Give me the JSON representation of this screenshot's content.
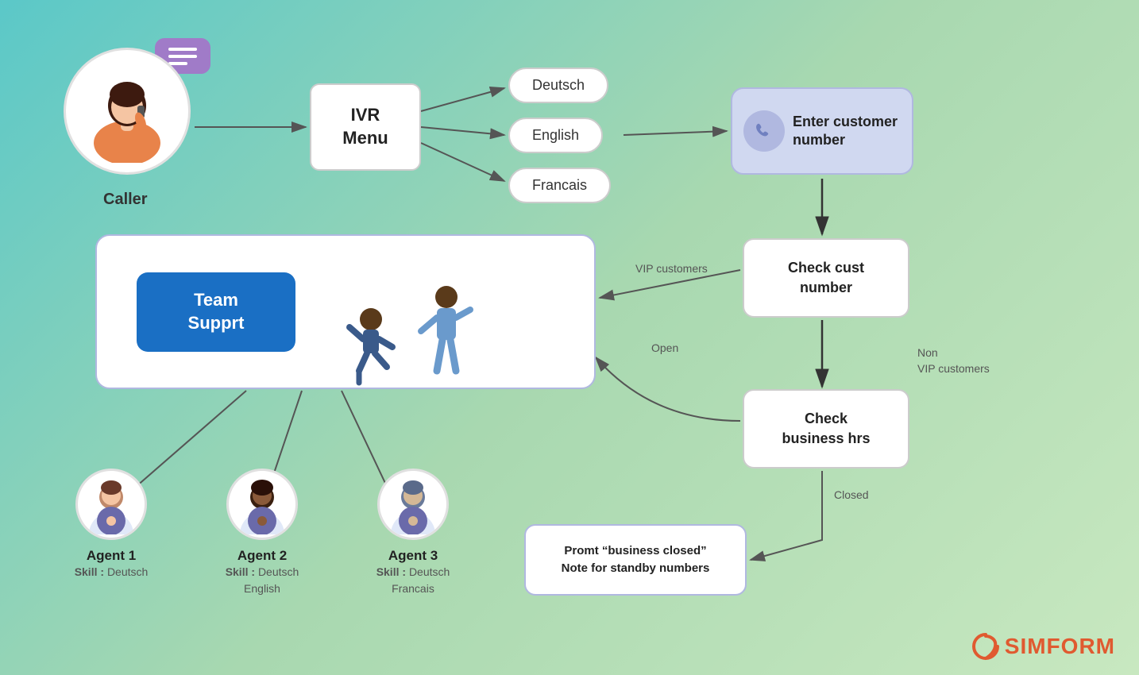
{
  "caller": {
    "label": "Caller"
  },
  "ivr": {
    "label": "IVR\nMenu"
  },
  "languages": [
    {
      "label": "Deutsch"
    },
    {
      "label": "English"
    },
    {
      "label": "Francais"
    }
  ],
  "enter_customer": {
    "label": "Enter customer number"
  },
  "check_cust": {
    "label": "Check cust number"
  },
  "check_biz": {
    "label": "Check business hrs"
  },
  "team_support": {
    "label": "Team\nSupprt"
  },
  "promt_box": {
    "line1": "Promt “business closed”",
    "line2": "Note for standby numbers"
  },
  "agents": [
    {
      "name": "Agent 1",
      "skill_label": "Skill :",
      "skill_value": "Deutsch"
    },
    {
      "name": "Agent 2",
      "skill_label": "Skill :",
      "skill_value": "Deutsch\nEnglish"
    },
    {
      "name": "Agent 3",
      "skill_label": "Skill :",
      "skill_value": "Deutsch\nFrancais"
    }
  ],
  "arrow_labels": {
    "vip": "VIP customers",
    "open": "Open",
    "closed": "Closed",
    "non_vip": "Non\nVIP customers"
  },
  "simform": {
    "text": "SIMFORM"
  }
}
